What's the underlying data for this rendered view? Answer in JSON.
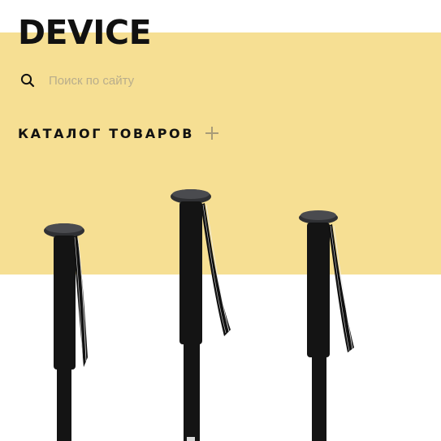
{
  "brand": {
    "logo_text": "DEVICE"
  },
  "search": {
    "placeholder": "Поиск по сайту",
    "icon": "search-icon"
  },
  "catalog": {
    "label": "КАТАЛОГ ТОВАРОВ",
    "icon": "plus-icon"
  },
  "colors": {
    "band": "#f6df93",
    "text": "#111111",
    "accent_plus": "#a89c78",
    "product": "#141414"
  },
  "products": [
    {
      "name": "monopod-left"
    },
    {
      "name": "monopod-center"
    },
    {
      "name": "monopod-right"
    }
  ]
}
